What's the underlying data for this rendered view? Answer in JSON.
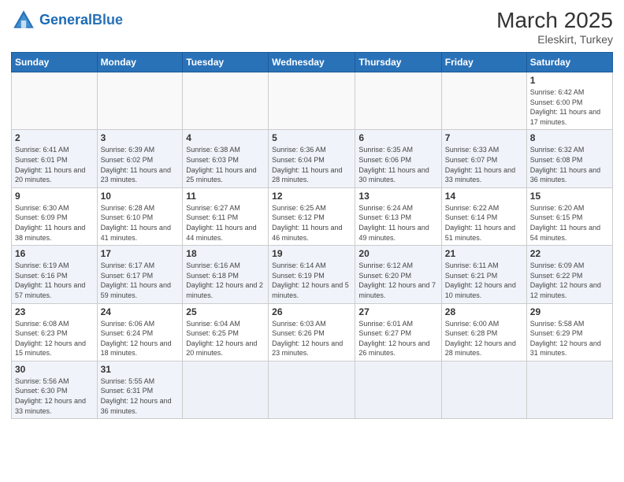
{
  "logo": {
    "text_general": "General",
    "text_blue": "Blue"
  },
  "title": "March 2025",
  "subtitle": "Eleskirt, Turkey",
  "weekdays": [
    "Sunday",
    "Monday",
    "Tuesday",
    "Wednesday",
    "Thursday",
    "Friday",
    "Saturday"
  ],
  "weeks": [
    [
      {
        "day": "",
        "info": ""
      },
      {
        "day": "",
        "info": ""
      },
      {
        "day": "",
        "info": ""
      },
      {
        "day": "",
        "info": ""
      },
      {
        "day": "",
        "info": ""
      },
      {
        "day": "",
        "info": ""
      },
      {
        "day": "1",
        "info": "Sunrise: 6:42 AM\nSunset: 6:00 PM\nDaylight: 11 hours and 17 minutes."
      }
    ],
    [
      {
        "day": "2",
        "info": "Sunrise: 6:41 AM\nSunset: 6:01 PM\nDaylight: 11 hours and 20 minutes."
      },
      {
        "day": "3",
        "info": "Sunrise: 6:39 AM\nSunset: 6:02 PM\nDaylight: 11 hours and 23 minutes."
      },
      {
        "day": "4",
        "info": "Sunrise: 6:38 AM\nSunset: 6:03 PM\nDaylight: 11 hours and 25 minutes."
      },
      {
        "day": "5",
        "info": "Sunrise: 6:36 AM\nSunset: 6:04 PM\nDaylight: 11 hours and 28 minutes."
      },
      {
        "day": "6",
        "info": "Sunrise: 6:35 AM\nSunset: 6:06 PM\nDaylight: 11 hours and 30 minutes."
      },
      {
        "day": "7",
        "info": "Sunrise: 6:33 AM\nSunset: 6:07 PM\nDaylight: 11 hours and 33 minutes."
      },
      {
        "day": "8",
        "info": "Sunrise: 6:32 AM\nSunset: 6:08 PM\nDaylight: 11 hours and 36 minutes."
      }
    ],
    [
      {
        "day": "9",
        "info": "Sunrise: 6:30 AM\nSunset: 6:09 PM\nDaylight: 11 hours and 38 minutes."
      },
      {
        "day": "10",
        "info": "Sunrise: 6:28 AM\nSunset: 6:10 PM\nDaylight: 11 hours and 41 minutes."
      },
      {
        "day": "11",
        "info": "Sunrise: 6:27 AM\nSunset: 6:11 PM\nDaylight: 11 hours and 44 minutes."
      },
      {
        "day": "12",
        "info": "Sunrise: 6:25 AM\nSunset: 6:12 PM\nDaylight: 11 hours and 46 minutes."
      },
      {
        "day": "13",
        "info": "Sunrise: 6:24 AM\nSunset: 6:13 PM\nDaylight: 11 hours and 49 minutes."
      },
      {
        "day": "14",
        "info": "Sunrise: 6:22 AM\nSunset: 6:14 PM\nDaylight: 11 hours and 51 minutes."
      },
      {
        "day": "15",
        "info": "Sunrise: 6:20 AM\nSunset: 6:15 PM\nDaylight: 11 hours and 54 minutes."
      }
    ],
    [
      {
        "day": "16",
        "info": "Sunrise: 6:19 AM\nSunset: 6:16 PM\nDaylight: 11 hours and 57 minutes."
      },
      {
        "day": "17",
        "info": "Sunrise: 6:17 AM\nSunset: 6:17 PM\nDaylight: 11 hours and 59 minutes."
      },
      {
        "day": "18",
        "info": "Sunrise: 6:16 AM\nSunset: 6:18 PM\nDaylight: 12 hours and 2 minutes."
      },
      {
        "day": "19",
        "info": "Sunrise: 6:14 AM\nSunset: 6:19 PM\nDaylight: 12 hours and 5 minutes."
      },
      {
        "day": "20",
        "info": "Sunrise: 6:12 AM\nSunset: 6:20 PM\nDaylight: 12 hours and 7 minutes."
      },
      {
        "day": "21",
        "info": "Sunrise: 6:11 AM\nSunset: 6:21 PM\nDaylight: 12 hours and 10 minutes."
      },
      {
        "day": "22",
        "info": "Sunrise: 6:09 AM\nSunset: 6:22 PM\nDaylight: 12 hours and 12 minutes."
      }
    ],
    [
      {
        "day": "23",
        "info": "Sunrise: 6:08 AM\nSunset: 6:23 PM\nDaylight: 12 hours and 15 minutes."
      },
      {
        "day": "24",
        "info": "Sunrise: 6:06 AM\nSunset: 6:24 PM\nDaylight: 12 hours and 18 minutes."
      },
      {
        "day": "25",
        "info": "Sunrise: 6:04 AM\nSunset: 6:25 PM\nDaylight: 12 hours and 20 minutes."
      },
      {
        "day": "26",
        "info": "Sunrise: 6:03 AM\nSunset: 6:26 PM\nDaylight: 12 hours and 23 minutes."
      },
      {
        "day": "27",
        "info": "Sunrise: 6:01 AM\nSunset: 6:27 PM\nDaylight: 12 hours and 26 minutes."
      },
      {
        "day": "28",
        "info": "Sunrise: 6:00 AM\nSunset: 6:28 PM\nDaylight: 12 hours and 28 minutes."
      },
      {
        "day": "29",
        "info": "Sunrise: 5:58 AM\nSunset: 6:29 PM\nDaylight: 12 hours and 31 minutes."
      }
    ],
    [
      {
        "day": "30",
        "info": "Sunrise: 5:56 AM\nSunset: 6:30 PM\nDaylight: 12 hours and 33 minutes."
      },
      {
        "day": "31",
        "info": "Sunrise: 5:55 AM\nSunset: 6:31 PM\nDaylight: 12 hours and 36 minutes."
      },
      {
        "day": "",
        "info": ""
      },
      {
        "day": "",
        "info": ""
      },
      {
        "day": "",
        "info": ""
      },
      {
        "day": "",
        "info": ""
      },
      {
        "day": "",
        "info": ""
      }
    ]
  ]
}
